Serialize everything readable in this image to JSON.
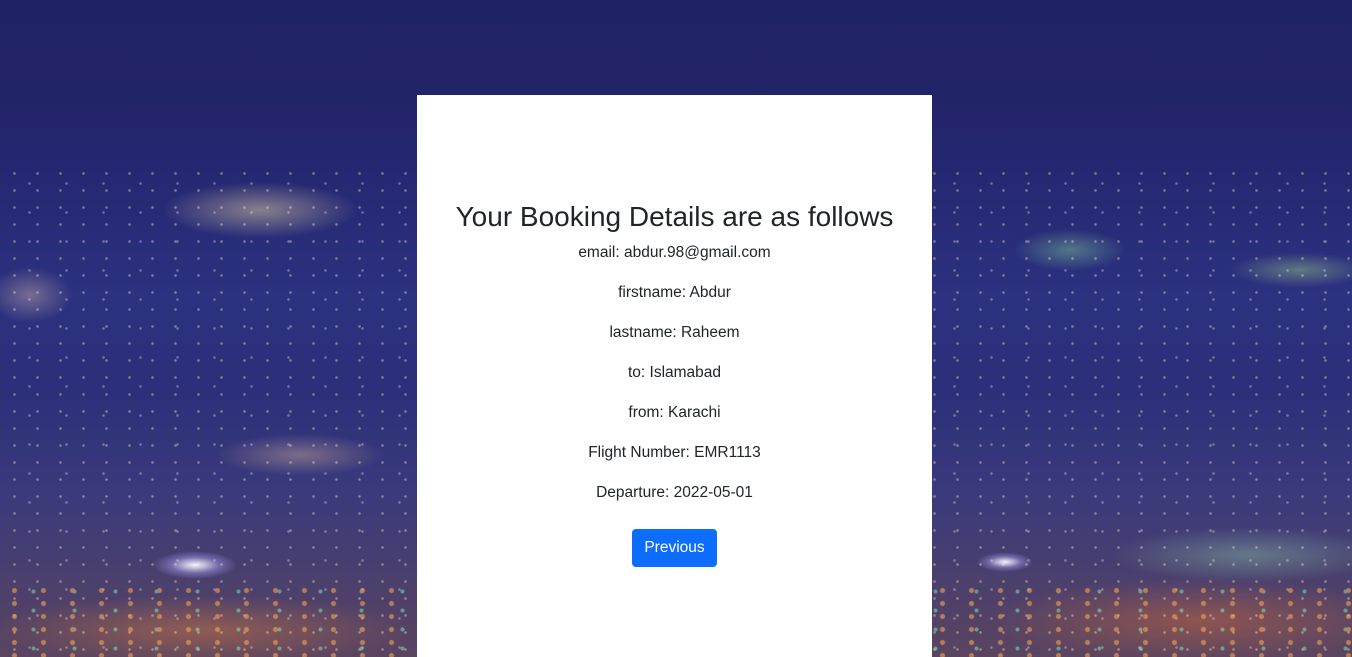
{
  "page": {
    "title": "Your Booking Details are as follows"
  },
  "booking": {
    "email_line": "email: abdur.98@gmail.com",
    "firstname_line": "firstname: Abdur",
    "lastname_line": "lastname: Raheem",
    "to_line": "to: Islamabad",
    "from_line": "from: Karachi",
    "flight_number_line": "Flight Number: EMR1113",
    "departure_line": "Departure: 2022-05-01"
  },
  "actions": {
    "previous_label": "Previous"
  },
  "colors": {
    "primary_button": "#0d6efd",
    "card_background": "#ffffff",
    "text": "#212529"
  }
}
